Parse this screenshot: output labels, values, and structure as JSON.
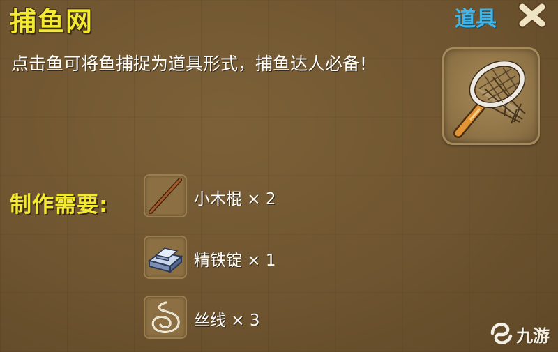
{
  "item": {
    "title": "捕鱼网",
    "category": "道具",
    "description": "点击鱼可将鱼捕捉为道具形式，捕鱼达人必备!",
    "icon": "fishing-net-icon"
  },
  "crafting": {
    "label": "制作需要:",
    "materials": [
      {
        "name": "小木棍 × 2",
        "icon": "wooden-stick-icon"
      },
      {
        "name": "精铁锭 × 1",
        "icon": "iron-ingot-icon"
      },
      {
        "name": "丝线 × 3",
        "icon": "thread-icon"
      }
    ]
  },
  "watermark": {
    "text": "九游",
    "icon": "jiuyou-logo-icon"
  },
  "colors": {
    "title": "#f3e92f",
    "category": "#3fb6ea",
    "background": "#6e5431"
  }
}
